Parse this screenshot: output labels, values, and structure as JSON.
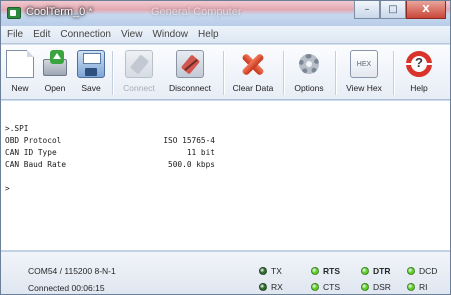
{
  "window": {
    "title": "CoolTerm_0 *",
    "background_title": "General Computer",
    "controls": {
      "minimize": "–",
      "maximize": "□",
      "close": "X"
    }
  },
  "menu": [
    "File",
    "Edit",
    "Connection",
    "View",
    "Window",
    "Help"
  ],
  "toolbar": {
    "buttons": [
      {
        "label": "New",
        "icon": "new-document-icon",
        "enabled": true
      },
      {
        "label": "Open",
        "icon": "open-folder-icon",
        "enabled": true
      },
      {
        "label": "Save",
        "icon": "floppy-disk-icon",
        "enabled": true
      },
      {
        "label": "Connect",
        "icon": "plug-connect-icon",
        "enabled": false
      },
      {
        "label": "Disconnect",
        "icon": "plug-disconnect-icon",
        "enabled": true
      },
      {
        "label": "Clear Data",
        "icon": "red-x-icon",
        "enabled": true
      },
      {
        "label": "Options",
        "icon": "gear-icon",
        "enabled": true
      },
      {
        "label": "View Hex",
        "icon": "hex-icon",
        "enabled": true,
        "icon_text": "HEX"
      },
      {
        "label": "Help",
        "icon": "lifebuoy-icon",
        "enabled": true,
        "icon_text": "?"
      }
    ]
  },
  "terminal": {
    "command": ">.SPI",
    "rows": [
      {
        "key": "OBD Protocol",
        "value": "ISO 15765-4"
      },
      {
        "key": "CAN ID Type",
        "value": "11 bit"
      },
      {
        "key": "CAN Baud Rate",
        "value": "500.0 kbps"
      }
    ],
    "prompt": ">"
  },
  "status": {
    "port": "COM54 / 115200 8-N-1",
    "connection": "Connected 00:06:15",
    "leds": [
      {
        "label": "TX",
        "color": "#2f6b2f",
        "bold": false
      },
      {
        "label": "RX",
        "color": "#2f6b2f",
        "bold": false
      },
      {
        "label": "RTS",
        "color": "#5fcf2f",
        "bold": true
      },
      {
        "label": "CTS",
        "color": "#5fcf2f",
        "bold": false
      },
      {
        "label": "DTR",
        "color": "#5fcf2f",
        "bold": true
      },
      {
        "label": "DSR",
        "color": "#5fcf2f",
        "bold": false
      },
      {
        "label": "DCD",
        "color": "#5fcf2f",
        "bold": false
      },
      {
        "label": "RI",
        "color": "#5fcf2f",
        "bold": false
      }
    ]
  }
}
